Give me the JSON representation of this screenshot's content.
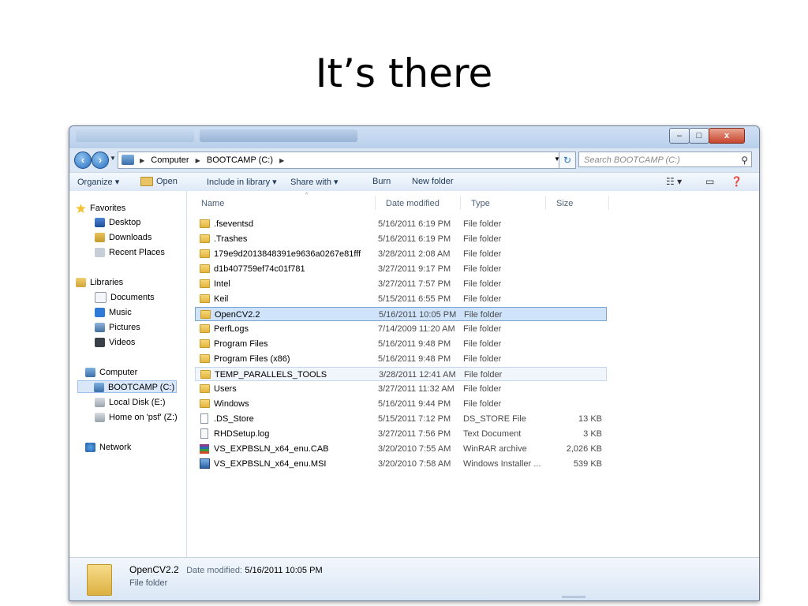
{
  "slide": {
    "title": "It’s there"
  },
  "window": {
    "controls": {
      "min": "–",
      "max": "□",
      "close": "x"
    }
  },
  "address": {
    "crumbs": [
      "Computer",
      "BOOTCAMP (C:)"
    ],
    "search_placeholder": "Search BOOTCAMP (C:)"
  },
  "toolbar": {
    "organize": "Organize ▾",
    "open": "Open",
    "include": "Include in library ▾",
    "share": "Share with ▾",
    "burn": "Burn",
    "new_folder": "New folder"
  },
  "nav": {
    "favorites": "Favorites",
    "desktop": "Desktop",
    "downloads": "Downloads",
    "recent": "Recent Places",
    "libraries": "Libraries",
    "documents": "Documents",
    "music": "Music",
    "pictures": "Pictures",
    "videos": "Videos",
    "computer": "Computer",
    "bootcamp": "BOOTCAMP (C:)",
    "local_disk": "Local Disk (E:)",
    "home_psf": "Home on 'psf' (Z:)",
    "network": "Network"
  },
  "columns": {
    "name": "Name",
    "date": "Date modified",
    "type": "Type",
    "size": "Size"
  },
  "files": [
    {
      "name": ".fseventsd",
      "date": "5/16/2011 6:19 PM",
      "type": "File folder",
      "size": "",
      "icon": "folder"
    },
    {
      "name": ".Trashes",
      "date": "5/16/2011 6:19 PM",
      "type": "File folder",
      "size": "",
      "icon": "folder"
    },
    {
      "name": "179e9d2013848391e9636a0267e81fff",
      "date": "3/28/2011 2:08 AM",
      "type": "File folder",
      "size": "",
      "icon": "folder"
    },
    {
      "name": "d1b407759ef74c01f781",
      "date": "3/27/2011 9:17 PM",
      "type": "File folder",
      "size": "",
      "icon": "folder"
    },
    {
      "name": "Intel",
      "date": "3/27/2011 7:57 PM",
      "type": "File folder",
      "size": "",
      "icon": "folder"
    },
    {
      "name": "Keil",
      "date": "5/15/2011 6:55 PM",
      "type": "File folder",
      "size": "",
      "icon": "folder"
    },
    {
      "name": "OpenCV2.2",
      "date": "5/16/2011 10:05 PM",
      "type": "File folder",
      "size": "",
      "icon": "folder"
    },
    {
      "name": "PerfLogs",
      "date": "7/14/2009 11:20 AM",
      "type": "File folder",
      "size": "",
      "icon": "folder"
    },
    {
      "name": "Program Files",
      "date": "5/16/2011 9:48 PM",
      "type": "File folder",
      "size": "",
      "icon": "folder"
    },
    {
      "name": "Program Files (x86)",
      "date": "5/16/2011 9:48 PM",
      "type": "File folder",
      "size": "",
      "icon": "folder"
    },
    {
      "name": "TEMP_PARALLELS_TOOLS",
      "date": "3/28/2011 12:41 AM",
      "type": "File folder",
      "size": "",
      "icon": "folder"
    },
    {
      "name": "Users",
      "date": "3/27/2011 11:32 AM",
      "type": "File folder",
      "size": "",
      "icon": "folder"
    },
    {
      "name": "Windows",
      "date": "5/16/2011 9:44 PM",
      "type": "File folder",
      "size": "",
      "icon": "folder"
    },
    {
      "name": ".DS_Store",
      "date": "5/15/2011 7:12 PM",
      "type": "DS_STORE File",
      "size": "13 KB",
      "icon": "file"
    },
    {
      "name": "RHDSetup.log",
      "date": "3/27/2011 7:56 PM",
      "type": "Text Document",
      "size": "3 KB",
      "icon": "log"
    },
    {
      "name": "VS_EXPBSLN_x64_enu.CAB",
      "date": "3/20/2010 7:55 AM",
      "type": "WinRAR archive",
      "size": "2,026 KB",
      "icon": "rar"
    },
    {
      "name": "VS_EXPBSLN_x64_enu.MSI",
      "date": "3/20/2010 7:58 AM",
      "type": "Windows Installer ...",
      "size": "539 KB",
      "icon": "msi"
    }
  ],
  "details": {
    "name": "OpenCV2.2",
    "date_label": "Date modified:",
    "date_value": "5/16/2011 10:05 PM",
    "type": "File folder"
  }
}
